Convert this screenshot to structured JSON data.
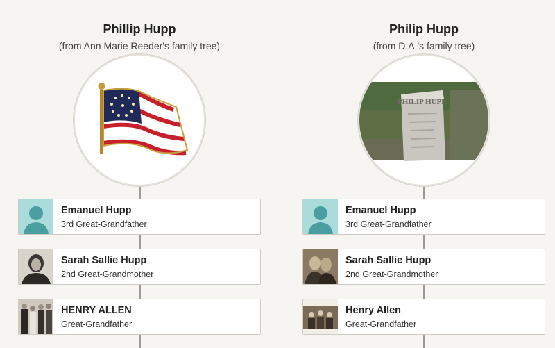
{
  "trees": [
    {
      "name": "Phillip Hupp",
      "source": "(from Ann Marie Reeder's family tree)",
      "ancestors": [
        {
          "name": "Emanuel Hupp",
          "relation": "3rd Great-Grandfather"
        },
        {
          "name": "Sarah Sallie Hupp",
          "relation": "2nd Great-Grandmother"
        },
        {
          "name": "HENRY ALLEN",
          "relation": "Great-Grandfather"
        }
      ]
    },
    {
      "name": "Philip Hupp",
      "source": "(from D.A.'s family tree)",
      "ancestors": [
        {
          "name": "Emanuel Hupp",
          "relation": "3rd Great-Grandfather"
        },
        {
          "name": "Sarah Sallie Hupp",
          "relation": "2nd Great-Grandmother"
        },
        {
          "name": "Henry Allen",
          "relation": "Great-Grandfather"
        }
      ]
    }
  ],
  "photo_captions": {
    "headstone_text": "PHILIP HUPP"
  },
  "colors": {
    "background": "#f6f5f2",
    "silhouette_bg": "#a9dcdb",
    "silhouette": "#4a9ea0",
    "connector": "#9e9b93"
  }
}
